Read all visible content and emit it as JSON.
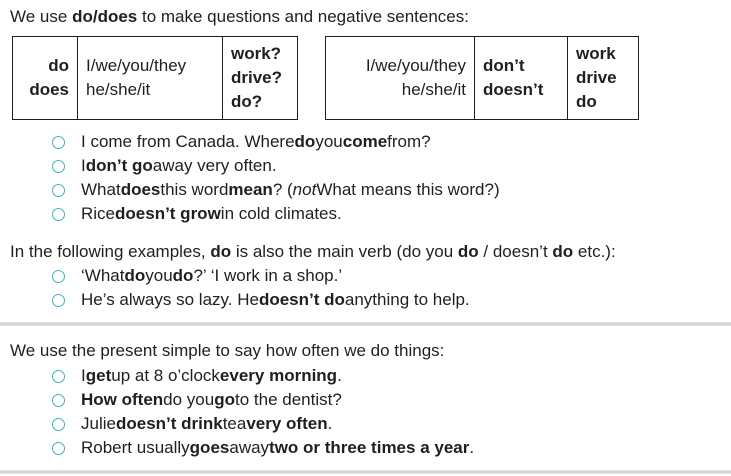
{
  "intro": [
    "We use ",
    "do",
    "/",
    "does",
    " to make questions and negative sentences:"
  ],
  "table1": {
    "col1": [
      "do",
      "does"
    ],
    "col2": [
      "I/we/you/they",
      "he/she/it"
    ],
    "col3": [
      "work?",
      "drive?",
      "do?"
    ]
  },
  "table2": {
    "col1": [
      "I/we/you/they",
      "he/she/it"
    ],
    "col2": [
      "don’t",
      "doesn’t"
    ],
    "col3": [
      "work",
      "drive",
      "do"
    ]
  },
  "examples1": [
    [
      "I come from Canada.  Where ",
      "do",
      " you ",
      "come",
      " from?"
    ],
    [
      "I ",
      "don’t go",
      " away very often."
    ],
    [
      "What ",
      "does",
      " this word ",
      "mean",
      "?  (",
      "not",
      " What means this word?)"
    ],
    [
      "Rice ",
      "doesn’t grow",
      " in cold climates."
    ]
  ],
  "following": [
    "In the following examples, ",
    "do",
    " is also the main verb (do you ",
    "do",
    " / doesn’t ",
    "do",
    " etc.):"
  ],
  "examples2": [
    [
      "‘What ",
      "do",
      " you ",
      "do",
      "?’  ‘I work in a shop.’"
    ],
    [
      "He’s always so lazy.  He ",
      "doesn’t do",
      " anything to help."
    ]
  ],
  "section2_intro": "We use the present simple to say how often we do things:",
  "examples3": [
    [
      "I ",
      "get",
      " up at 8 o’clock ",
      "every morning",
      "."
    ],
    [
      "How often",
      " do you ",
      "go",
      " to the dentist?"
    ],
    [
      "Julie ",
      "doesn’t drink",
      " tea ",
      "very often",
      "."
    ],
    [
      "Robert usually ",
      "goes",
      " away ",
      "two or three times a year",
      "."
    ]
  ]
}
